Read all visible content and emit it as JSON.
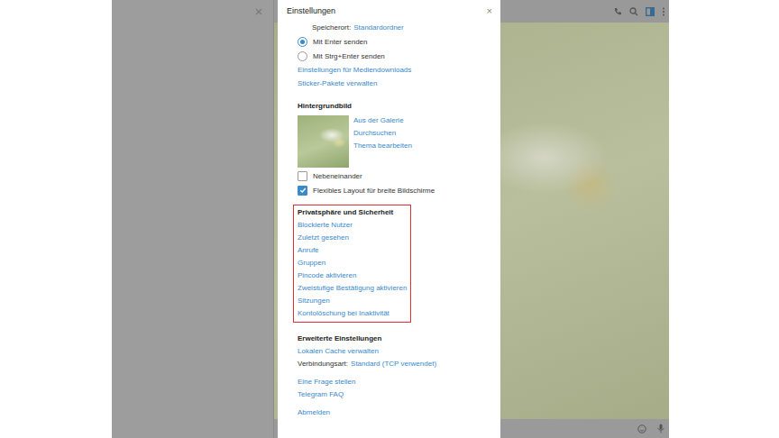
{
  "window": {
    "title": "Einstellungen",
    "close": "×"
  },
  "storage": {
    "label": "Speicherort:",
    "value": "Standardordner"
  },
  "send_options": [
    {
      "label": "Mit Enter senden",
      "selected": true
    },
    {
      "label": "Mit Strg+Enter senden",
      "selected": false
    }
  ],
  "general_links": [
    "Einstellungen für Mediendownloads",
    "Sticker-Pakete verwalten"
  ],
  "background": {
    "title": "Hintergrundbild",
    "links": [
      "Aus der Galerie",
      "Durchsuchen",
      "Thema bearbeiten"
    ]
  },
  "layout_options": [
    {
      "label": "Nebeneinander",
      "checked": false
    },
    {
      "label": "Flexibles Layout für breite Bildschirme",
      "checked": true
    }
  ],
  "privacy": {
    "title": "Privatsphäre und Sicherheit",
    "highlighted": true,
    "links": [
      "Blockierte Nutzer",
      "Zuletzt gesehen",
      "Anrufe",
      "Gruppen",
      "Pincode aktivieren",
      "Zweistufige Bestätigung aktivieren",
      "Sitzungen",
      "Kontolöschung bei Inaktivität"
    ]
  },
  "advanced": {
    "title": "Erweiterte Einstellungen",
    "links": [
      "Lokalen Cache verwalten"
    ],
    "connection": {
      "label": "Verbindungsart:",
      "value": "Standard (TCP verwendet)"
    }
  },
  "footer_links": [
    "Eine Frage stellen",
    "Telegram FAQ"
  ],
  "logout": "Abmelden"
}
